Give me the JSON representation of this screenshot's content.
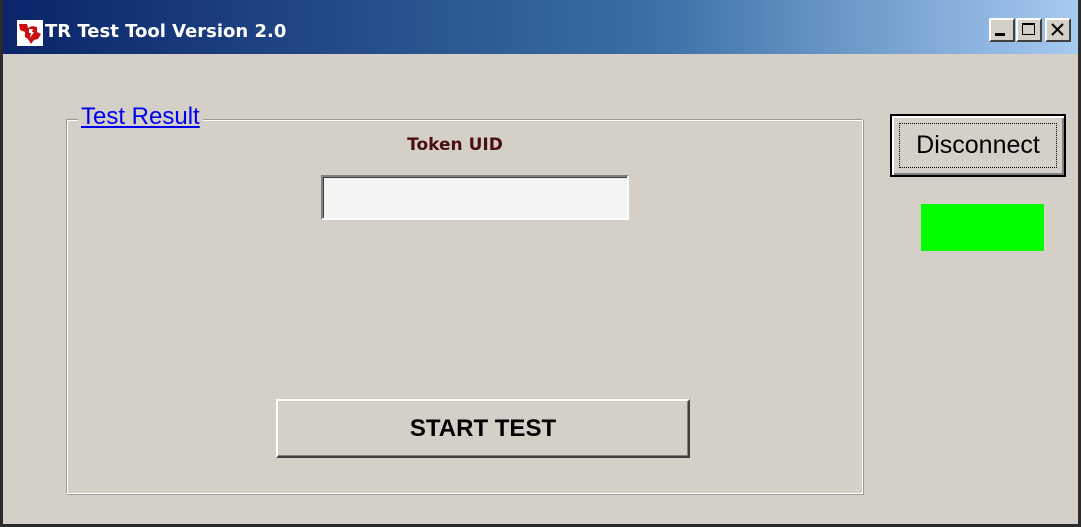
{
  "window": {
    "title": "TR Test Tool Version 2.0",
    "icon": "ti-logo-icon",
    "controls": {
      "minimize": "minimize-icon",
      "maximize": "maximize-icon",
      "close": "close-icon"
    }
  },
  "test_result": {
    "group_label": "Test Result",
    "token_uid_label": "Token UID",
    "token_uid_value": "",
    "start_button_label": "START TEST"
  },
  "connection": {
    "disconnect_label": "Disconnect",
    "status_color": "#00ff00"
  },
  "colors": {
    "title_gradient_start": "#0a246a",
    "title_gradient_end": "#a6caf0",
    "window_bg": "#d4d0c8",
    "link_blue": "#0000ee",
    "label_maroon": "#4a0f0f",
    "status_green": "#00ff00"
  }
}
